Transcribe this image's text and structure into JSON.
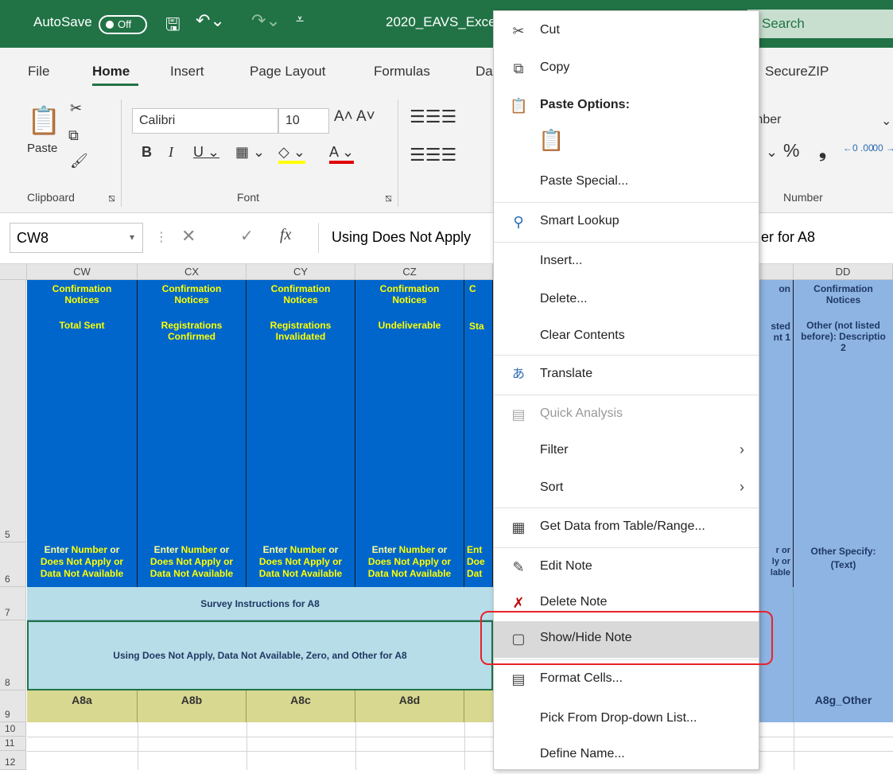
{
  "titlebar": {
    "autosave": "AutoSave",
    "toggle": "Off",
    "filename": "2020_EAVS_Exce",
    "search": "Search"
  },
  "menu": {
    "file": "File",
    "home": "Home",
    "insert": "Insert",
    "page_layout": "Page Layout",
    "formulas": "Formulas",
    "data_partial": "Da",
    "securezip": "SecureZIP"
  },
  "ribbon": {
    "font_name": "Calibri",
    "font_size": "10",
    "paste": "Paste",
    "number_partial": "mber",
    "clipboard": "Clipboard",
    "font": "Font",
    "number": "Number",
    "percent": "%",
    "comma": "❟",
    "inc_dec": "←0 .00",
    "dec_dec": ".00 →.0"
  },
  "formula_bar": {
    "name_box": "CW8",
    "fx": "fx",
    "text": "Using Does Not Apply",
    "text_right": "er for A8"
  },
  "columns": [
    "CW",
    "CX",
    "CY",
    "CZ",
    "DD"
  ],
  "rows": [
    "5",
    "6",
    "7",
    "8",
    "9",
    "10",
    "11",
    "12"
  ],
  "header_cells": [
    {
      "line1": "Confirmation",
      "line2": "Notices",
      "line3": "Total Sent",
      "line4": ""
    },
    {
      "line1": "Confirmation",
      "line2": "Notices",
      "line3": "Registrations",
      "line4": "Confirmed"
    },
    {
      "line1": "Confirmation",
      "line2": "Notices",
      "line3": "Registrations",
      "line4": "Invalidated"
    },
    {
      "line1": "Confirmation",
      "line2": "Notices",
      "line3": "Undeliverable",
      "line4": ""
    }
  ],
  "partial_cells": {
    "c1": "C",
    "sta": "Sta",
    "on": "on",
    "sted": "sted",
    "nt1": "nt 1",
    "r_or": "r or",
    "ly_or": "ly or",
    "lable": "lable"
  },
  "dd_cell": {
    "line1": "Confirmation",
    "line2": "Notices",
    "line3": "Other (not listed",
    "line4": "before): Descriptio",
    "line5": "2",
    "instr": "Other Specify:",
    "instr2": "(Text)",
    "code": "A8g_Other"
  },
  "instructions": {
    "l1a": "Enter ",
    "l1b": "Number",
    "l1c": " or",
    "l2": "Does Not Apply or",
    "l3": "Data Not Available",
    "partial": "Ent",
    "partial2": "Doe",
    "partial3": "Dat"
  },
  "row7": "Survey Instructions for A8",
  "row8": "Using Does Not Apply, Data Not Available, Zero, and Other for A8",
  "codes": [
    "A8a",
    "A8b",
    "A8c",
    "A8d"
  ],
  "context_menu": {
    "cut": "Cut",
    "copy": "Copy",
    "paste_options": "Paste Options:",
    "paste_special": "Paste Special...",
    "smart_lookup": "Smart Lookup",
    "insert": "Insert...",
    "delete": "Delete...",
    "clear_contents": "Clear Contents",
    "translate": "Translate",
    "quick_analysis": "Quick Analysis",
    "filter": "Filter",
    "sort": "Sort",
    "get_data": "Get Data from Table/Range...",
    "edit_note": "Edit Note",
    "delete_note": "Delete Note",
    "show_hide_note": "Show/Hide Note",
    "format_cells": "Format Cells...",
    "pick_dropdown": "Pick From Drop-down List...",
    "define_name": "Define Name..."
  },
  "colors": {
    "excel_green": "#217346",
    "header_blue": "#0066cc",
    "light_blue": "#8eb4e3",
    "instr_blue": "#b7dde8",
    "code_green": "#d8d890",
    "highlight": "#e8232a"
  }
}
